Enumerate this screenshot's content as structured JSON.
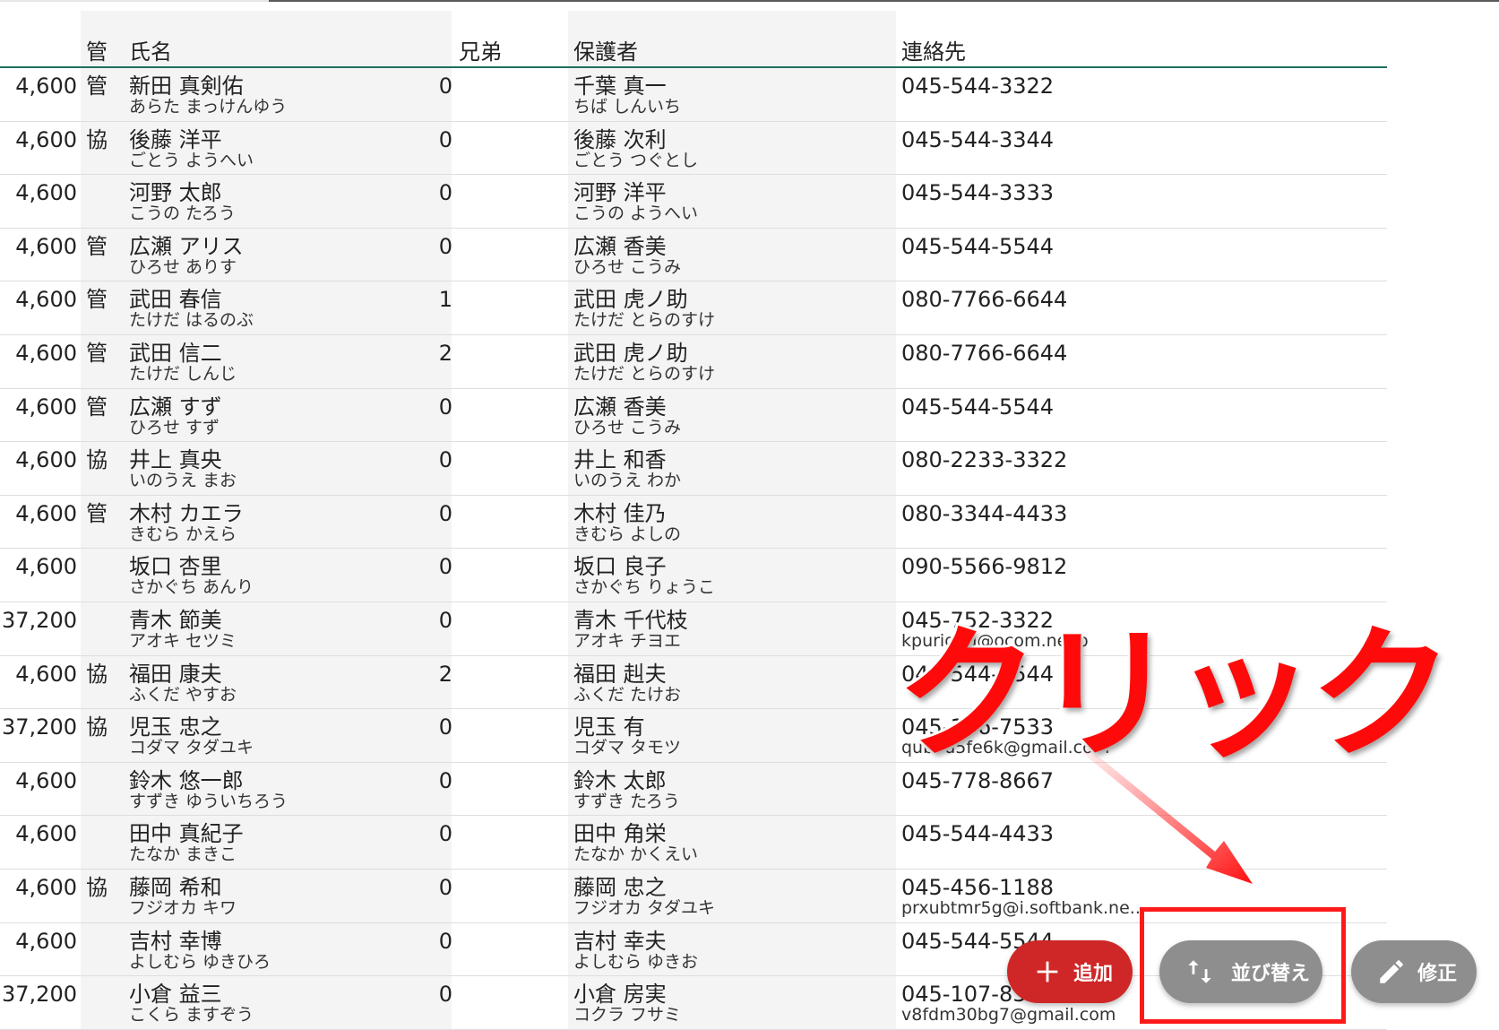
{
  "header": {
    "col_mgmt": "管",
    "col_name": "氏名",
    "col_sibling": "兄弟",
    "col_guardian": "保護者",
    "col_contact": "連絡先"
  },
  "rows": [
    {
      "fee": "4,600",
      "mgmt": "管",
      "name": "新田 真剣佑",
      "name_kana": "あらた まっけんゆう",
      "sibling": "0",
      "guardian": "千葉 真一",
      "guardian_kana": "ちば しんいち",
      "phone": "045-544-3322",
      "email": ""
    },
    {
      "fee": "4,600",
      "mgmt": "協",
      "name": "後藤 洋平",
      "name_kana": "ごとう ようへい",
      "sibling": "0",
      "guardian": "後藤 次利",
      "guardian_kana": "ごとう つぐとし",
      "phone": "045-544-3344",
      "email": ""
    },
    {
      "fee": "4,600",
      "mgmt": "",
      "name": "河野 太郎",
      "name_kana": "こうの たろう",
      "sibling": "0",
      "guardian": "河野 洋平",
      "guardian_kana": "こうの ようへい",
      "phone": "045-544-3333",
      "email": ""
    },
    {
      "fee": "4,600",
      "mgmt": "管",
      "name": "広瀬 アリス",
      "name_kana": "ひろせ ありす",
      "sibling": "0",
      "guardian": "広瀬 香美",
      "guardian_kana": "ひろせ こうみ",
      "phone": "045-544-5544",
      "email": ""
    },
    {
      "fee": "4,600",
      "mgmt": "管",
      "name": "武田 春信",
      "name_kana": "たけだ はるのぶ",
      "sibling": "1",
      "guardian": "武田 虎ノ助",
      "guardian_kana": "たけだ とらのすけ",
      "phone": "080-7766-6644",
      "email": ""
    },
    {
      "fee": "4,600",
      "mgmt": "管",
      "name": "武田 信二",
      "name_kana": "たけだ しんじ",
      "sibling": "2",
      "guardian": "武田 虎ノ助",
      "guardian_kana": "たけだ とらのすけ",
      "phone": "080-7766-6644",
      "email": ""
    },
    {
      "fee": "4,600",
      "mgmt": "管",
      "name": "広瀬 すず",
      "name_kana": "ひろせ すず",
      "sibling": "0",
      "guardian": "広瀬 香美",
      "guardian_kana": "ひろせ こうみ",
      "phone": "045-544-5544",
      "email": ""
    },
    {
      "fee": "4,600",
      "mgmt": "協",
      "name": "井上 真央",
      "name_kana": "いのうえ まお",
      "sibling": "0",
      "guardian": "井上 和香",
      "guardian_kana": "いのうえ わか",
      "phone": "080-2233-3322",
      "email": ""
    },
    {
      "fee": "4,600",
      "mgmt": "管",
      "name": "木村 カエラ",
      "name_kana": "きむら かえら",
      "sibling": "0",
      "guardian": "木村 佳乃",
      "guardian_kana": "きむら よしの",
      "phone": "080-3344-4433",
      "email": ""
    },
    {
      "fee": "4,600",
      "mgmt": "",
      "name": "坂口 杏里",
      "name_kana": "さかぐち あんり",
      "sibling": "0",
      "guardian": "坂口 良子",
      "guardian_kana": "さかぐち りょうこ",
      "phone": "090-5566-9812",
      "email": ""
    },
    {
      "fee": "37,200",
      "mgmt": "",
      "name": "青木 節美",
      "name_kana": "アオキ セツミ",
      "sibling": "0",
      "guardian": "青木 千代枝",
      "guardian_kana": "アオキ チヨエ",
      "phone": "045-752-3322",
      "email": "kpuriggu@ocom.ne.jp"
    },
    {
      "fee": "4,600",
      "mgmt": "協",
      "name": "福田 康夫",
      "name_kana": "ふくだ やすお",
      "sibling": "2",
      "guardian": "福田 赳夫",
      "guardian_kana": "ふくだ たけお",
      "phone": "045-544-5544",
      "email": ""
    },
    {
      "fee": "37,200",
      "mgmt": "協",
      "name": "児玉 忠之",
      "name_kana": "コダマ タダユキ",
      "sibling": "0",
      "guardian": "児玉 有",
      "guardian_kana": "コダマ タモツ",
      "phone": "045-146-7533",
      "email": "qub7u5fe6k@gmail.com"
    },
    {
      "fee": "4,600",
      "mgmt": "",
      "name": "鈴木 悠一郎",
      "name_kana": "すずき ゆういちろう",
      "sibling": "0",
      "guardian": "鈴木 太郎",
      "guardian_kana": "すずき たろう",
      "phone": "045-778-8667",
      "email": ""
    },
    {
      "fee": "4,600",
      "mgmt": "",
      "name": "田中 真紀子",
      "name_kana": "たなか まきこ",
      "sibling": "0",
      "guardian": "田中 角栄",
      "guardian_kana": "たなか かくえい",
      "phone": "045-544-4433",
      "email": ""
    },
    {
      "fee": "4,600",
      "mgmt": "協",
      "name": "藤岡 希和",
      "name_kana": "フジオカ キワ",
      "sibling": "0",
      "guardian": "藤岡 忠之",
      "guardian_kana": "フジオカ タダユキ",
      "phone": "045-456-1188",
      "email": "prxubtmr5g@i.softbank.ne.."
    },
    {
      "fee": "4,600",
      "mgmt": "",
      "name": "吉村 幸博",
      "name_kana": "よしむら ゆきひろ",
      "sibling": "0",
      "guardian": "吉村 幸夫",
      "guardian_kana": "よしむら ゆきお",
      "phone": "045-544-5544",
      "email": ""
    },
    {
      "fee": "37,200",
      "mgmt": "",
      "name": "小倉 益三",
      "name_kana": "こくら ますぞう",
      "sibling": "0",
      "guardian": "小倉 房実",
      "guardian_kana": "コクラ フサミ",
      "phone": "045-107-8322",
      "email": "v8fdm30bg7@gmail.com"
    }
  ],
  "buttons": {
    "add_label": "追加",
    "sort_label": "並び替え",
    "edit_label": "修正",
    "add_icon": "plus-icon",
    "sort_icon": "sort-arrows-icon",
    "edit_icon": "pencil-icon"
  },
  "annotation": {
    "text": "クリック",
    "color": "#ff0a0a"
  },
  "colors": {
    "header_line": "#1f6f5c",
    "add_button": "#cf2727",
    "secondary_button": "#8e8e8e",
    "column_shade": "#f4f4f4"
  }
}
